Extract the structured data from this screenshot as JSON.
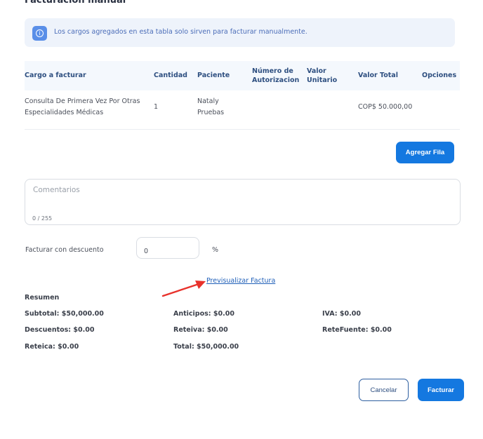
{
  "page": {
    "title": "Facturación manual"
  },
  "info": {
    "icon": "info-icon",
    "text": "Los cargos agregados en esta tabla solo sirven para facturar manualmente."
  },
  "table": {
    "headers": {
      "cargo": "Cargo a facturar",
      "cantidad": "Cantidad",
      "paciente": "Paciente",
      "numero_1": "Número de",
      "numero_2": "Autorizacion",
      "valor_1": "Valor",
      "valor_2": "Unitario",
      "total": "Valor Total",
      "opciones": "Opciones"
    },
    "rows": [
      {
        "cargo_1": "Consulta De Primera Vez Por Otras",
        "cargo_2": "Especialidades Médicas",
        "cantidad": "1",
        "paciente_1": "Nataly",
        "paciente_2": "Pruebas",
        "numero": "",
        "valor_unitario": "",
        "total": "COP$ 50.000,00"
      }
    ]
  },
  "buttons": {
    "add_row": "Agregar Fila",
    "cancel": "Cancelar",
    "invoice": "Facturar"
  },
  "comments": {
    "placeholder": "Comentarios",
    "counter": "0 / 255"
  },
  "discount": {
    "label": "Facturar con descuento",
    "value": "0",
    "unit": "%"
  },
  "preview_link": "Previsualizar Factura",
  "annotation": {
    "arrow_color": "#e8322c"
  },
  "summary": {
    "title": "Resumen",
    "subtotal": "Subtotal: $50,000.00",
    "anticipos": "Anticipos: $0.00",
    "iva": "IVA: $0.00",
    "descuentos": "Descuentos: $0.00",
    "reteiva": "Reteiva: $0.00",
    "retefuente": "ReteFuente: $0.00",
    "reteica": "Reteica: $0.00",
    "total": "Total: $50,000.00"
  },
  "colors": {
    "primary": "#1478e0",
    "info_bg": "#eef3fb",
    "header_bg": "#f4f8fd"
  }
}
